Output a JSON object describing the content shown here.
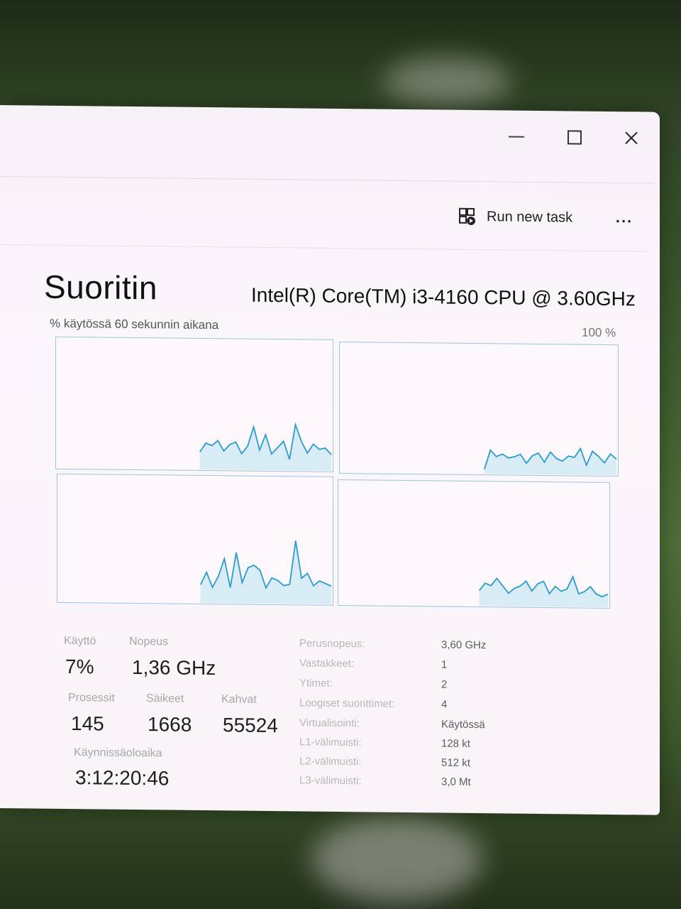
{
  "window": {
    "minimize_label": "—",
    "close_label": "×"
  },
  "toolbar": {
    "run_new_task": "Run new task",
    "more": "..."
  },
  "header": {
    "title": "Suoritin",
    "cpu_model": "Intel(R) Core(TM) i3-4160 CPU @ 3.60GHz",
    "graph_caption": "% käytössä 60 sekunnin aikana",
    "graph_max": "100 %"
  },
  "stats": {
    "usage_label": "Käyttö",
    "usage_value": "7%",
    "speed_label": "Nopeus",
    "speed_value": "1,36 GHz",
    "processes_label": "Prosessit",
    "processes_value": "145",
    "threads_label": "Säikeet",
    "threads_value": "1668",
    "handles_label": "Kahvat",
    "handles_value": "55524",
    "uptime_label": "Käynnissäoloaika",
    "uptime_value": "3:12:20:46"
  },
  "specs": [
    {
      "label": "Perusnopeus:",
      "value": "3,60 GHz"
    },
    {
      "label": "Vastakkeet:",
      "value": "1"
    },
    {
      "label": "Ytimet:",
      "value": "2"
    },
    {
      "label": "Loogiset suorittimet:",
      "value": "4"
    },
    {
      "label": "Virtualisointi:",
      "value": "Käytössä"
    },
    {
      "label": "L1-välimuisti:",
      "value": "128 kt"
    },
    {
      "label": "L2-välimuisti:",
      "value": "512 kt"
    },
    {
      "label": "L3-välimuisti:",
      "value": "3,0 Mt"
    }
  ],
  "graphs": [
    {
      "name": "logical-cpu-0",
      "values": [
        13,
        20,
        18,
        22,
        14,
        19,
        21,
        12,
        18,
        33,
        15,
        27,
        12,
        17,
        22,
        8,
        35,
        22,
        13,
        20,
        16,
        17,
        12
      ]
    },
    {
      "name": "logical-cpu-1",
      "values": [
        3,
        18,
        13,
        15,
        12,
        13,
        15,
        8,
        14,
        16,
        9,
        17,
        12,
        10,
        14,
        13,
        20,
        7,
        18,
        14,
        9,
        16,
        12
      ]
    },
    {
      "name": "logical-cpu-2",
      "values": [
        14,
        24,
        12,
        21,
        35,
        12,
        40,
        16,
        28,
        30,
        26,
        12,
        20,
        18,
        14,
        15,
        50,
        20,
        24,
        14,
        18,
        16,
        14
      ]
    },
    {
      "name": "logical-cpu-3",
      "values": [
        12,
        18,
        16,
        22,
        16,
        10,
        14,
        16,
        20,
        12,
        18,
        20,
        10,
        16,
        12,
        14,
        24,
        10,
        12,
        16,
        10,
        8,
        10
      ]
    }
  ],
  "colors": {
    "graph_line": "#2b9ccf",
    "graph_fill": "#d7ecf4",
    "graph_border": "#9fc6d9"
  }
}
